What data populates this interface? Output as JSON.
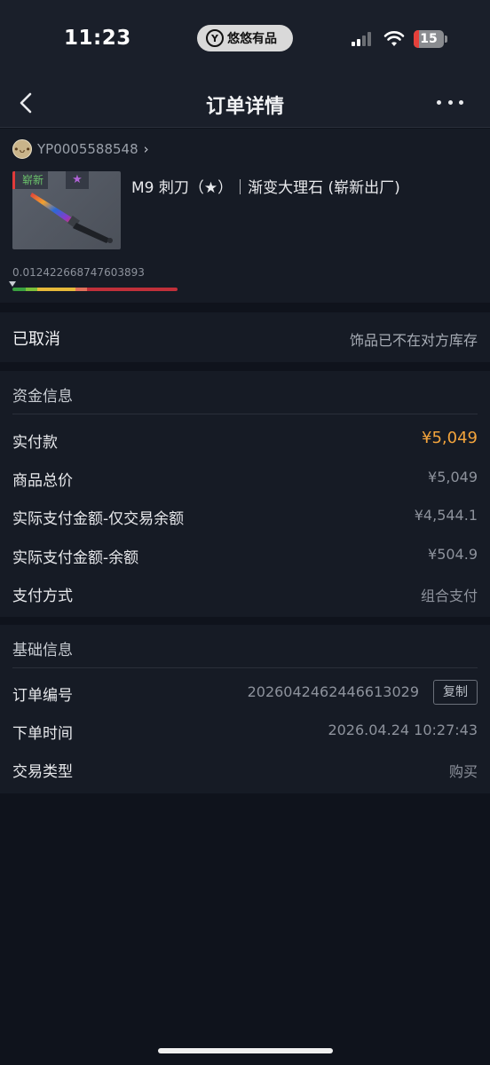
{
  "status_bar": {
    "time": "11:23",
    "app_name": "悠悠有品",
    "battery": "15"
  },
  "nav": {
    "title": "订单详情",
    "back_icon": "chevron-left-icon",
    "more_icon": "more-horizontal-icon"
  },
  "item": {
    "seller_id": "YP0005588548",
    "seller_chevron": "›",
    "wear_tag": "崭新",
    "star_tag": "★",
    "name": "M9 刺刀（★）｜渐变大理石 (崭新出厂)",
    "float": "0.012422668747603893",
    "float_fraction": 0.0124,
    "float_bar_colors": [
      "#3aa040",
      "#7bbf3a",
      "#e6b93a",
      "#e0705a",
      "#c0303a"
    ]
  },
  "order_status": {
    "label": "已取消",
    "reason": "饰品已不在对方库存"
  },
  "funds": {
    "title": "资金信息",
    "rows": [
      {
        "label": "实付款",
        "value": "¥5,049"
      },
      {
        "label": "商品总价",
        "value": "¥5,049"
      },
      {
        "label": "实际支付金额-仅交易余额",
        "value": "¥4,544.1"
      },
      {
        "label": "实际支付金额-余额",
        "value": "¥504.9"
      },
      {
        "label": "支付方式",
        "value": "组合支付"
      }
    ],
    "accent_color": "#f3a43c"
  },
  "basic": {
    "title": "基础信息",
    "rows": [
      {
        "label": "订单编号",
        "value": "2026042462446613029"
      },
      {
        "label": "下单时间",
        "value": "2026.04.24 10:27:43"
      },
      {
        "label": "交易类型",
        "value": "购买"
      }
    ],
    "copy_label": "复制"
  }
}
